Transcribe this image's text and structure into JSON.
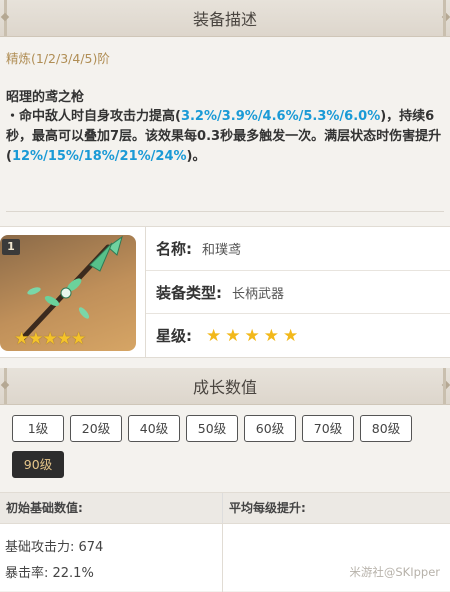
{
  "description": {
    "title": "装备描述",
    "refine": "精炼(1/2/3/4/5)阶",
    "skill_name": "昭理的鸢之枪",
    "text_a": "・命中敌人时自身攻击力提高(",
    "atk_values": "3.2%/3.9%/4.6%/5.3%/6.0%",
    "text_b": ")，持续6秒，最高可以叠加7层。该效果每0.3秒最多触发一次。满层状态时伤害提升(",
    "dmg_values": "12%/15%/18%/21%/24%",
    "text_c": ")。"
  },
  "weapon": {
    "badge": "1",
    "name_label": "名称:",
    "name": "和璞鸢",
    "type_label": "装备类型:",
    "type": "长柄武器",
    "rarity_label": "星级:",
    "rarity": 5,
    "stars": "★★★★★"
  },
  "growth": {
    "title": "成长数值",
    "levels": [
      "1级",
      "20级",
      "40级",
      "50级",
      "60级",
      "70级",
      "80级",
      "90级"
    ],
    "active_level": "90级",
    "table": {
      "head_base": "初始基础数值:",
      "head_avg": "平均每级提升:",
      "atk": "基础攻击力: 674",
      "crit": "暴击率: 22.1%"
    }
  },
  "watermark": "米游社@SKIpper",
  "colors": {
    "highlight": "#1a9ad6",
    "refine": "#b08e55",
    "star": "#f2b81a"
  }
}
